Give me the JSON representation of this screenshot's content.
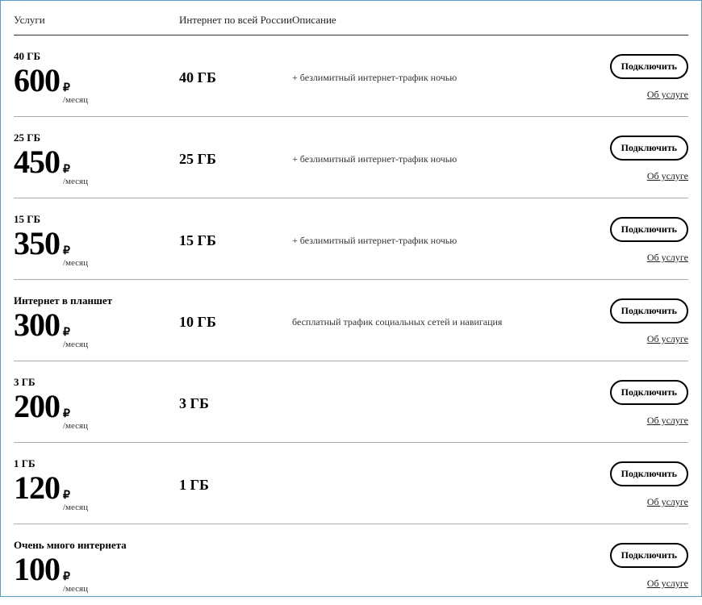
{
  "headers": {
    "services": "Услуги",
    "internet": "Интернет по всей России",
    "description": "Описание"
  },
  "currency": "₽",
  "period": "/месяц",
  "connect_label": "Подключить",
  "about_label": "Об услуге",
  "plans": [
    {
      "name": "40 ГБ",
      "price": "600",
      "internet": "40 ГБ",
      "desc": "+ безлимитный интернет-трафик ночью"
    },
    {
      "name": "25 ГБ",
      "price": "450",
      "internet": "25 ГБ",
      "desc": "+ безлимитный интернет-трафик ночью"
    },
    {
      "name": "15 ГБ",
      "price": "350",
      "internet": "15 ГБ",
      "desc": "+ безлимитный интернет-трафик ночью"
    },
    {
      "name": "Интернет в планшет",
      "price": "300",
      "internet": "10 ГБ",
      "desc": "бесплатный трафик социальных сетей и навигация"
    },
    {
      "name": "3 ГБ",
      "price": "200",
      "internet": "3 ГБ",
      "desc": ""
    },
    {
      "name": "1 ГБ",
      "price": "120",
      "internet": "1 ГБ",
      "desc": ""
    },
    {
      "name": "Очень много интернета",
      "price": "100",
      "internet": "",
      "desc": ""
    }
  ]
}
